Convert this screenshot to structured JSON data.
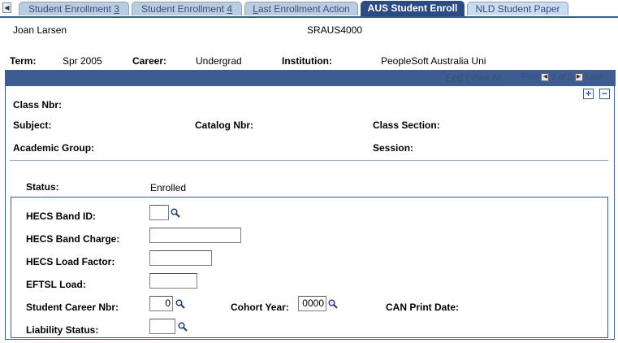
{
  "tabs": [
    {
      "label": "Student Enrollment 3",
      "prefix": "Student Enrollment ",
      "key": "3"
    },
    {
      "label": "Student Enrollment 4",
      "prefix": "Student Enrollment ",
      "key": "4"
    },
    {
      "label": "Last Enrollment Action",
      "key": "L",
      "rest": "ast Enrollment Action"
    },
    {
      "label": "AUS Student Enroll"
    },
    {
      "label": "NLD Student Paper"
    }
  ],
  "header": {
    "student_name": "Joan Larsen",
    "student_id": "SRAUS4000",
    "term_label": "Term:",
    "term_value": "Spr 2005",
    "career_label": "Career:",
    "career_value": "Undergrad",
    "institution_label": "Institution:",
    "institution_value": "PeopleSoft Australia Uni"
  },
  "nav": {
    "find": "Find",
    "separator": " | ",
    "view_all": "View All",
    "first": "First",
    "count": "1 of 1",
    "last": "Last",
    "add": "+",
    "remove": "−"
  },
  "class_info": {
    "class_nbr_label": "Class Nbr:",
    "subject_label": "Subject:",
    "catalog_nbr_label": "Catalog Nbr:",
    "class_section_label": "Class Section:",
    "academic_group_label": "Academic Group:",
    "session_label": "Session:",
    "status_label": "Status:",
    "status_value": "Enrolled"
  },
  "hecs": {
    "band_id_label": "HECS Band ID:",
    "band_id_value": "",
    "band_charge_label": "HECS Band Charge:",
    "band_charge_value": "",
    "load_factor_label": "HECS Load Factor:",
    "load_factor_value": "",
    "eftsl_label": "EFTSL Load:",
    "eftsl_value": "",
    "career_nbr_label": "Student Career Nbr:",
    "career_nbr_value": "0",
    "cohort_year_label": "Cohort Year:",
    "cohort_year_value": "0000",
    "can_print_label": "CAN Print Date:",
    "liability_label": "Liability Status:",
    "liability_value": ""
  },
  "colors": {
    "accent": "#3d5c92",
    "tab_inactive": "#b9cde2",
    "tab_active": "#2c4b82"
  },
  "icons": {
    "lookup": "magnifying-glass",
    "scroll_left": "triangle-left",
    "prev": "triangle-left",
    "next": "triangle-right"
  }
}
